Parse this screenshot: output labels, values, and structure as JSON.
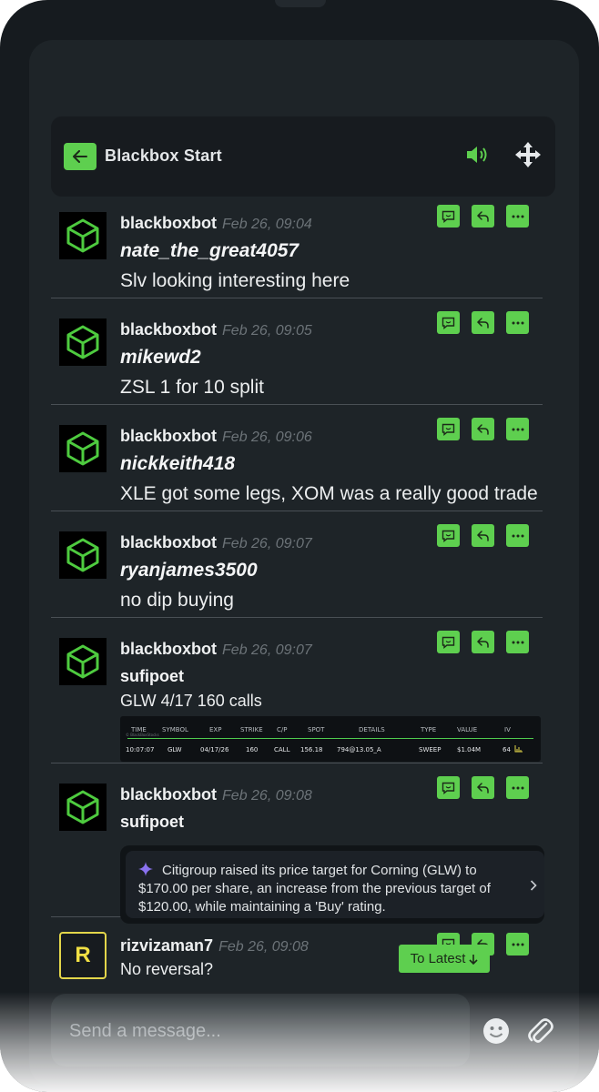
{
  "header": {
    "title": "Blackbox Start"
  },
  "messages": [
    {
      "author": "blackboxbot",
      "time": "Feb 26, 09:04",
      "user": "nate_the_great4057",
      "text": "Slv looking interesting here"
    },
    {
      "author": "blackboxbot",
      "time": "Feb 26, 09:05",
      "user": "mikewd2",
      "text": "ZSL 1 for 10 split"
    },
    {
      "author": "blackboxbot",
      "time": "Feb 26, 09:06",
      "user": "nickkeith418",
      "text": "XLE got some legs, XOM was a really good trade"
    },
    {
      "author": "blackboxbot",
      "time": "Feb 26, 09:07",
      "user": "ryanjames3500",
      "text": "no dip buying"
    },
    {
      "author": "blackboxbot",
      "time": "Feb 26, 09:07",
      "user": "sufipoet",
      "text": "GLW 4/17 160 calls"
    },
    {
      "author": "blackboxbot",
      "time": "Feb 26, 09:08",
      "user": "sufipoet",
      "text": ""
    },
    {
      "author": "rizvizaman7",
      "avatar_letter": "R",
      "time": "Feb 26, 09:08",
      "text": "No reversal?"
    }
  ],
  "flow_table": {
    "brand": "© BlackBoxStocks",
    "headers": [
      "TIME",
      "SYMBOL",
      "EXP",
      "STRIKE",
      "C/P",
      "SPOT",
      "DETAILS",
      "TYPE",
      "VALUE",
      "IV"
    ],
    "row": [
      "10:07:07",
      "GLW",
      "04/17/26",
      "160",
      "CALL",
      "156.18",
      "794@13.05_A",
      "SWEEP",
      "$1.04M",
      "64"
    ]
  },
  "insight": {
    "text": "Citigroup raised its price target for Corning (GLW) to $170.00 per share, an increase from the previous target of $120.00, while maintaining a 'Buy' rating."
  },
  "to_latest": {
    "label": "To Latest"
  },
  "composer": {
    "placeholder": "Send a message..."
  },
  "colors": {
    "accent": "#5ecf4f",
    "background": "#1e2428",
    "header": "#171b1f",
    "user_avatar": "#f0df44"
  },
  "icons": {
    "back": "arrow-left-icon",
    "sound": "speaker-icon",
    "move": "move-arrows-icon",
    "reply_thread": "chat-bubble-icon",
    "reply": "reply-arrow-icon",
    "more": "ellipsis-icon",
    "emoji": "smiley-icon",
    "attach": "paperclip-icon"
  }
}
